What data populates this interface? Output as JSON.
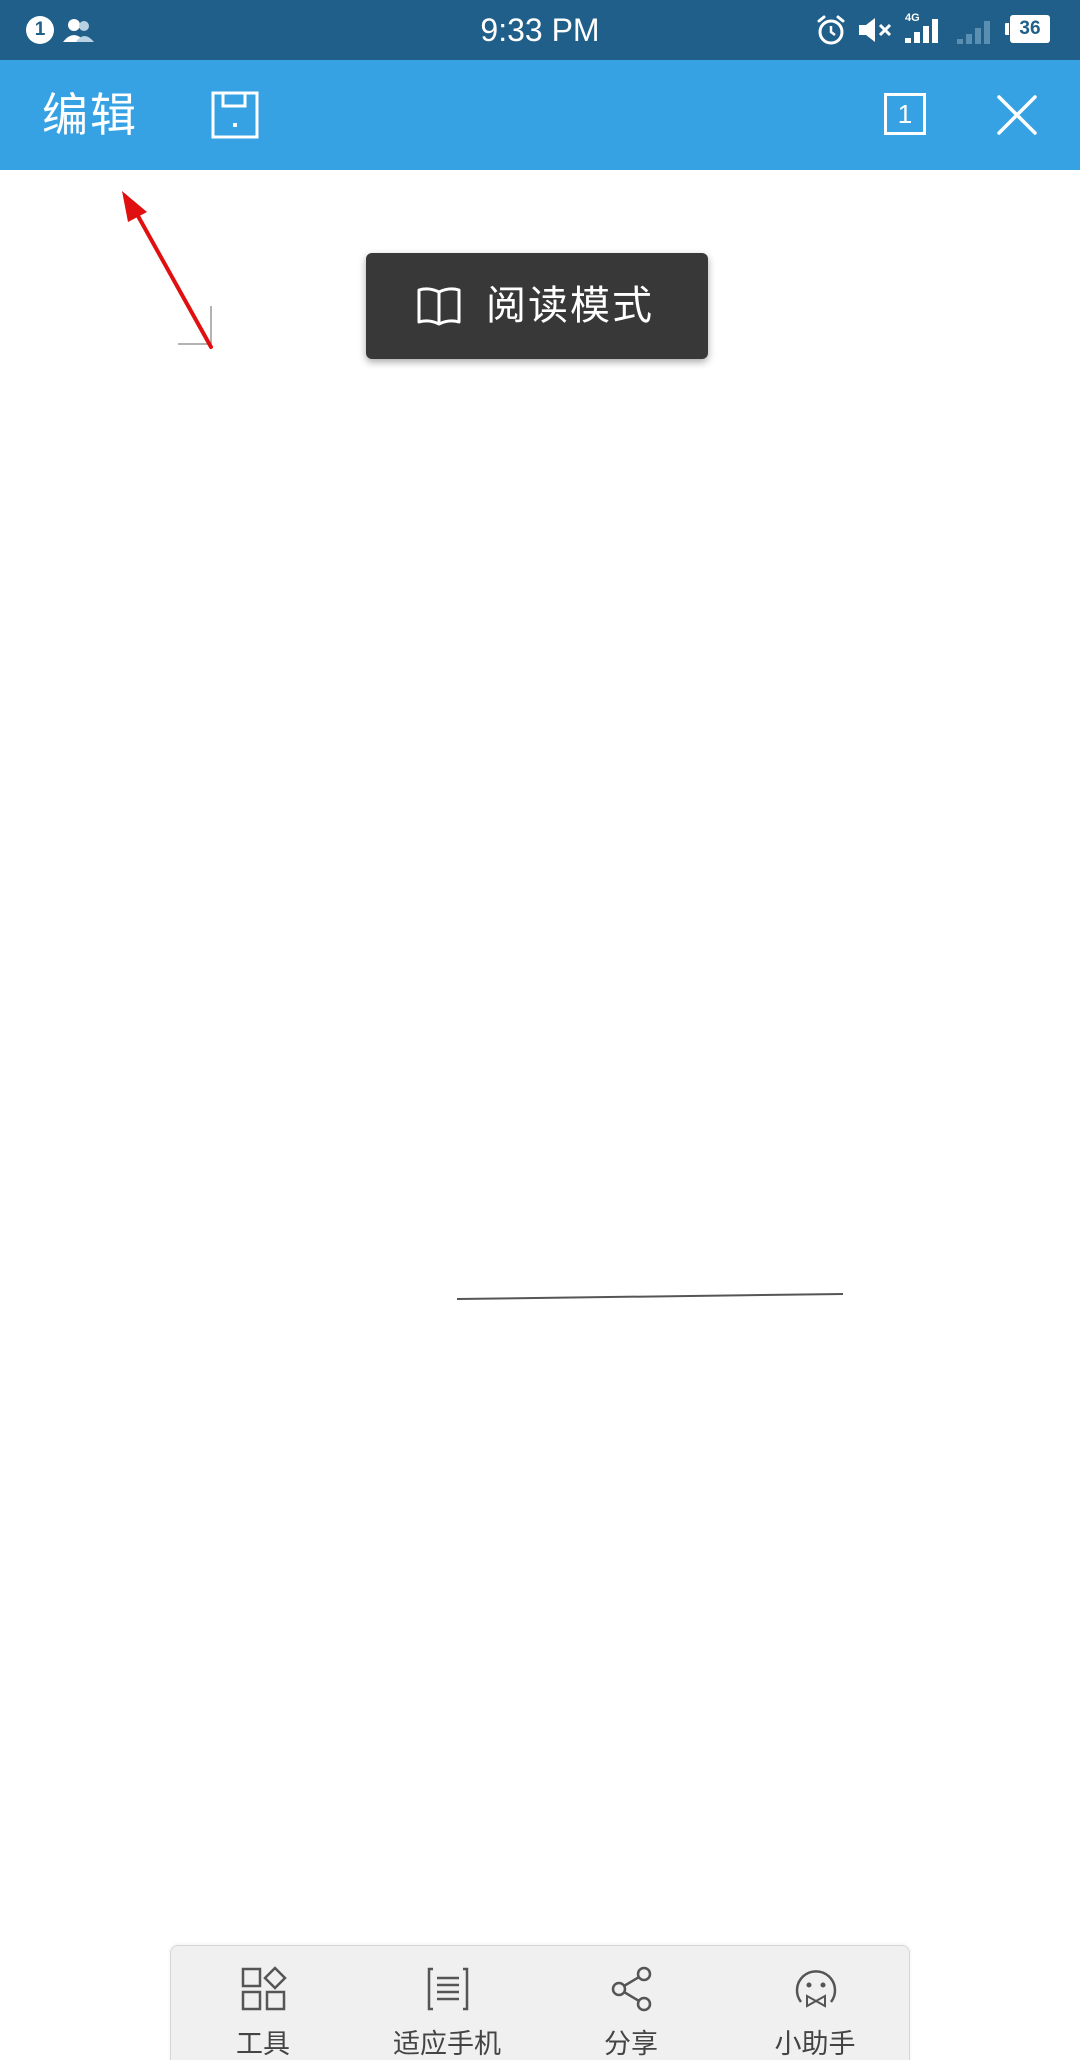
{
  "status_bar": {
    "notification_count": "1",
    "time": "9:33 PM",
    "network": "4G",
    "battery": "36"
  },
  "app_bar": {
    "title": "编辑",
    "page_count": "1",
    "background_color": "#36a2e4"
  },
  "toast": {
    "label": "阅读模式",
    "icon": "book-open-icon"
  },
  "toolbar": {
    "items": [
      {
        "label": "工具",
        "icon": "tools-grid-icon"
      },
      {
        "label": "适应手机",
        "icon": "fit-phone-icon"
      },
      {
        "label": "分享",
        "icon": "share-icon"
      },
      {
        "label": "小助手",
        "icon": "assistant-icon"
      }
    ]
  },
  "colors": {
    "status_bar": "#1f5f8a",
    "annotation_arrow": "#e01010",
    "toast_bg": "#383838"
  }
}
